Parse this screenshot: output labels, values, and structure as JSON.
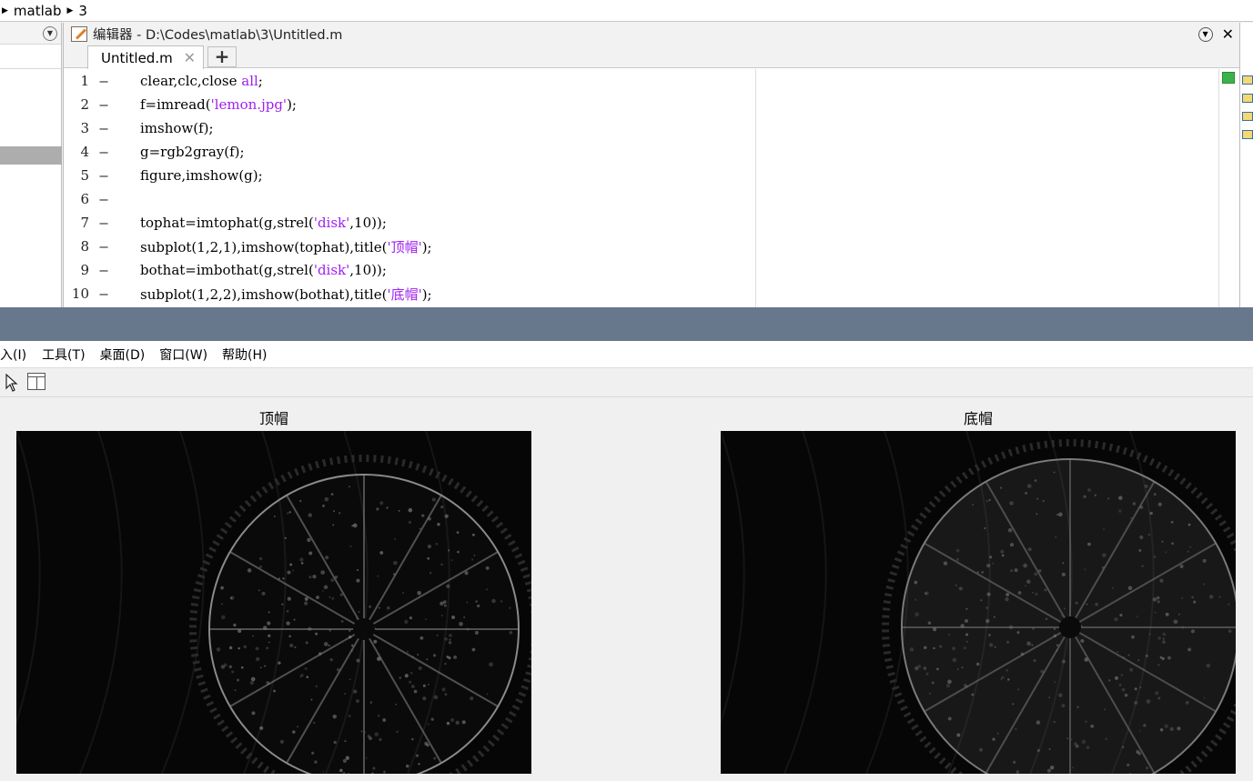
{
  "breadcrumb": {
    "items": [
      "matlab",
      "3"
    ]
  },
  "editor": {
    "title": "编辑器 - D:\\Codes\\matlab\\3\\Untitled.m",
    "tab_label": "Untitled.m",
    "lines": [
      {
        "n": "1",
        "parts": [
          [
            "clear,clc,close ",
            "n"
          ],
          [
            "all",
            "k"
          ],
          [
            ";",
            "n"
          ]
        ]
      },
      {
        "n": "2",
        "parts": [
          [
            "f=imread(",
            "n"
          ],
          [
            "'lemon.jpg'",
            "k"
          ],
          [
            ");",
            "n"
          ]
        ]
      },
      {
        "n": "3",
        "parts": [
          [
            "imshow(f);",
            "n"
          ]
        ]
      },
      {
        "n": "4",
        "parts": [
          [
            "g=rgb2gray(f);",
            "n"
          ]
        ]
      },
      {
        "n": "5",
        "parts": [
          [
            "figure,imshow(g);",
            "n"
          ]
        ]
      },
      {
        "n": "6",
        "parts": []
      },
      {
        "n": "7",
        "parts": [
          [
            "tophat=imtophat(g,strel(",
            "n"
          ],
          [
            "'disk'",
            "k"
          ],
          [
            ",10));",
            "n"
          ]
        ]
      },
      {
        "n": "8",
        "parts": [
          [
            "subplot(1,2,1),imshow(tophat),title(",
            "n"
          ],
          [
            "'顶帽'",
            "k"
          ],
          [
            ");",
            "n"
          ]
        ]
      },
      {
        "n": "9",
        "parts": [
          [
            "bothat=imbothat(g,strel(",
            "n"
          ],
          [
            "'disk'",
            "k"
          ],
          [
            ",10));",
            "n"
          ]
        ]
      },
      {
        "n": "10",
        "parts": [
          [
            "subplot(1,2,2),imshow(bothat),title(",
            "n"
          ],
          [
            "'底帽'",
            "k"
          ],
          [
            ");",
            "n"
          ]
        ]
      }
    ]
  },
  "figure": {
    "menu": [
      "入(I)",
      "工具(T)",
      "桌面(D)",
      "窗口(W)",
      "帮助(H)"
    ],
    "axes": [
      {
        "title": "顶帽"
      },
      {
        "title": "底帽"
      }
    ]
  },
  "colors": {
    "keyword": "#a020f0",
    "splitter": "#68788c",
    "status_ok": "#3cb34a"
  }
}
